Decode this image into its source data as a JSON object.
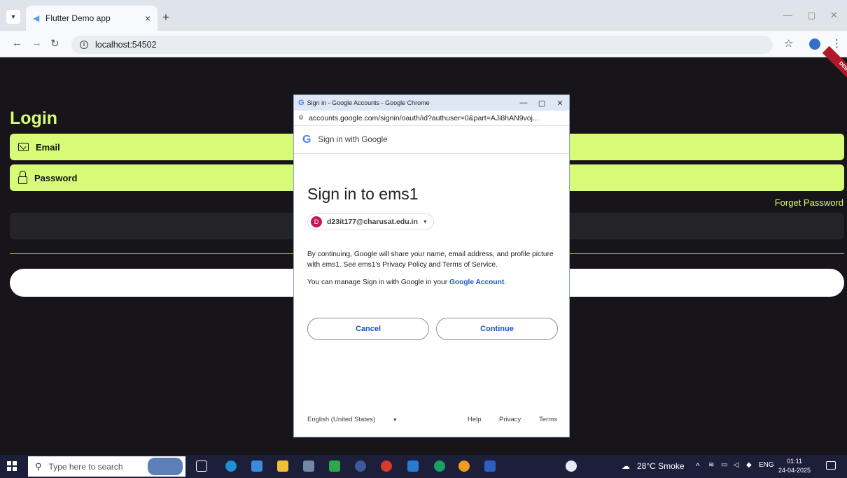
{
  "browser": {
    "tab_title": "Flutter Demo app",
    "tab_close": "×",
    "new_tab": "+",
    "url": "localhost:54502"
  },
  "app": {
    "debug_label": "DEBUG",
    "login_title": "Login",
    "email_label": "Email",
    "password_label": "Password",
    "forget_password": "Forget Password",
    "accent_color": "#d8fb77"
  },
  "popup": {
    "window_title": "Sign in - Google Accounts - Google Chrome",
    "url": "accounts.google.com/signin/oauth/id?authuser=0&part=AJi8hAN9voj...",
    "header": "Sign in with Google",
    "heading": "Sign in to ems1",
    "account_initial": "D",
    "account_email": "d23it177@charusat.edu.in",
    "consent_text": "By continuing, Google will share your name, email address, and profile picture with ems1. See ems1's Privacy Policy and Terms of Service.",
    "manage_text": "You can manage Sign in with Google in your",
    "manage_link": "Google Account",
    "cancel_label": "Cancel",
    "continue_label": "Continue",
    "language": "English (United States)",
    "help": "Help",
    "privacy": "Privacy",
    "terms": "Terms"
  },
  "taskbar": {
    "search_placeholder": "Type here to search",
    "weather": "28°C Smoke",
    "language": "ENG",
    "time": "01:11",
    "date": "24-04-2025"
  }
}
